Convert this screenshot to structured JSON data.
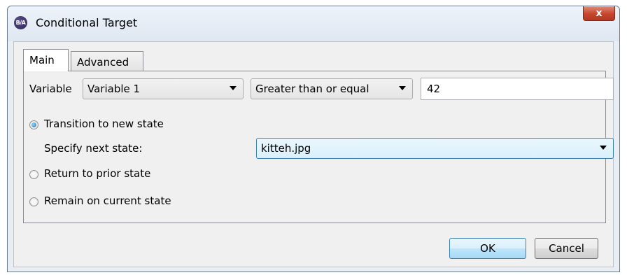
{
  "window": {
    "title": "Conditional Target",
    "app_icon": "B/A",
    "close_label": "x"
  },
  "tabs": [
    {
      "label": "Main",
      "active": true
    },
    {
      "label": "Advanced",
      "active": false
    }
  ],
  "condition": {
    "variable_label": "Variable",
    "variable_value": "Variable 1",
    "operator_value": "Greater than or equal",
    "compare_value": "42"
  },
  "options": {
    "transition_label": "Transition to new state",
    "specify_next_label": "Specify next state:",
    "next_state_value": "kitteh.jpg",
    "return_label": "Return to prior state",
    "remain_label": "Remain on current state",
    "selected": "transition"
  },
  "buttons": {
    "ok": "OK",
    "cancel": "Cancel"
  }
}
